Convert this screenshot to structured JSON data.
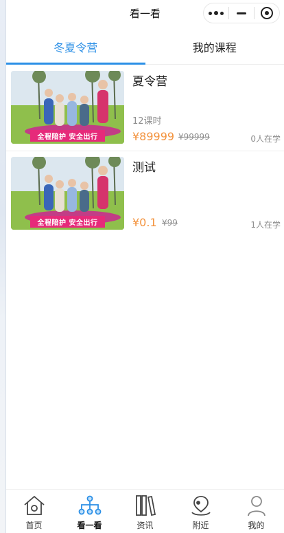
{
  "header": {
    "title": "看一看"
  },
  "tabs": [
    {
      "label": "冬夏令营",
      "active": true
    },
    {
      "label": "我的课程",
      "active": false
    }
  ],
  "courses": [
    {
      "name": "夏令营",
      "hours": "12课时",
      "price": "¥89999",
      "original_price": "¥99999",
      "learners": "0人在学",
      "thumb_banner": "全程陪护 安全出行"
    },
    {
      "name": "测试",
      "hours": "",
      "price": "¥0.1",
      "original_price": "¥99",
      "learners": "1人在学",
      "thumb_banner": "全程陪护 安全出行"
    }
  ],
  "bottom_nav": [
    {
      "label": "首页",
      "icon": "home-icon",
      "active": false
    },
    {
      "label": "看一看",
      "icon": "network-icon",
      "active": true
    },
    {
      "label": "资讯",
      "icon": "books-icon",
      "active": false
    },
    {
      "label": "附近",
      "icon": "location-icon",
      "active": false
    },
    {
      "label": "我的",
      "icon": "user-icon",
      "active": false
    }
  ],
  "colors": {
    "accent": "#2b8fe6",
    "price": "#f3923c",
    "banner": "#e62a7a"
  }
}
